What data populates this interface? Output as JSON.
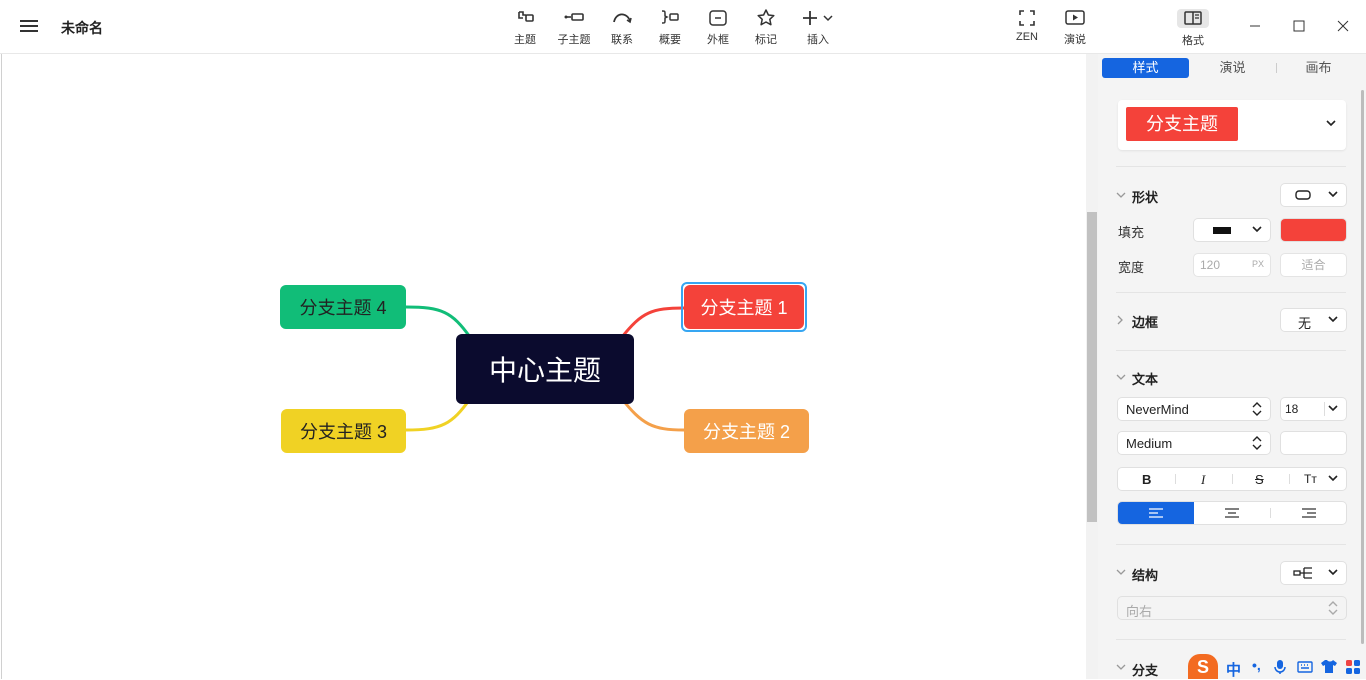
{
  "app": {
    "title": "未命名"
  },
  "toolbar": {
    "items": [
      {
        "name": "topic",
        "label": "主题"
      },
      {
        "name": "subtopic",
        "label": "子主题"
      },
      {
        "name": "relation",
        "label": "联系"
      },
      {
        "name": "summary",
        "label": "概要"
      },
      {
        "name": "boundary",
        "label": "外框"
      },
      {
        "name": "marker",
        "label": "标记"
      },
      {
        "name": "insert",
        "label": "插入"
      },
      {
        "name": "zen",
        "label": "ZEN"
      },
      {
        "name": "pitch",
        "label": "演说"
      },
      {
        "name": "format",
        "label": "格式"
      }
    ]
  },
  "map": {
    "central": {
      "label": "中心主题",
      "color": "#0b0b2e"
    },
    "branches": [
      {
        "label": "分支主题 1",
        "color": "#f4423a",
        "selected": true
      },
      {
        "label": "分支主题 2",
        "color": "#f4a04a"
      },
      {
        "label": "分支主题 3",
        "color": "#f0d224",
        "text_color": "#222"
      },
      {
        "label": "分支主题 4",
        "color": "#11bd78",
        "text_color": "#222"
      }
    ],
    "selection_color": "#36a6f2"
  },
  "panel": {
    "tabs": [
      {
        "label": "样式",
        "active": true
      },
      {
        "label": "演说"
      },
      {
        "label": "画布"
      }
    ],
    "style_preview": {
      "label": "分支主题",
      "color": "#f4423a"
    },
    "shape": {
      "title": "形状"
    },
    "fill": {
      "label": "填充",
      "color": "#f4423a"
    },
    "width": {
      "label": "宽度",
      "value": "120",
      "unit": "PX",
      "fit": "适合"
    },
    "border": {
      "title": "边框",
      "value": "无"
    },
    "text": {
      "title": "文本",
      "font": "NeverMind",
      "size": "18",
      "weight": "Medium",
      "bold": "B",
      "italic": "I",
      "strike": "S",
      "case": "Tт"
    },
    "structure": {
      "title": "结构",
      "direction": "向右"
    },
    "branch": {
      "title": "分支"
    }
  },
  "accent": "#1565e0",
  "tray": {
    "ime": "中",
    "punct": "•,"
  }
}
